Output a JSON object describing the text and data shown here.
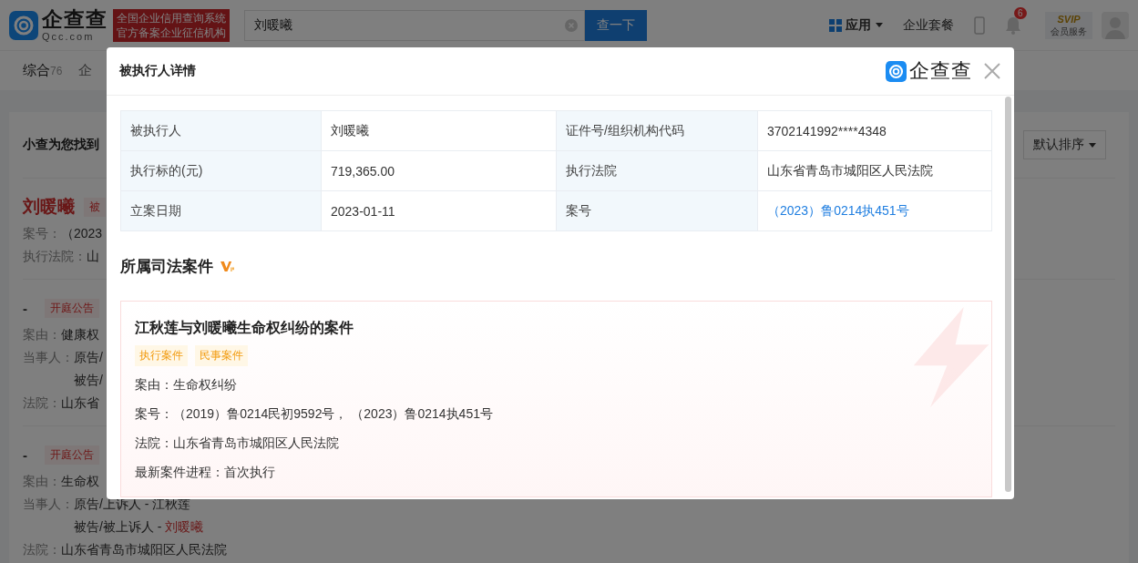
{
  "header": {
    "logo_text": "企查查",
    "logo_domain": "Qcc.com",
    "slogan": [
      "全国企业信用查询系统",
      "官方备案企业征信机构"
    ],
    "search": {
      "value": "刘暖曦"
    },
    "search_button": "查一下",
    "nav": [
      "应用",
      "企业套餐"
    ],
    "notification_count": "6",
    "vip": {
      "badge": "SVIP",
      "label": "会员服务"
    }
  },
  "tabs": [
    {
      "label": "综合",
      "count": "76",
      "selected": true
    },
    {
      "label": "企",
      "selected": false
    }
  ],
  "results": {
    "summary": "小查为您找到",
    "sort_button": "默认排序",
    "items": [
      {
        "kind": "person",
        "title": "刘暖曦",
        "tag": "被",
        "fields": [
          {
            "label": "案号：",
            "lines": [
              {
                "text": "（2023"
              }
            ]
          },
          {
            "label": "执行法院：",
            "lines": [
              {
                "text": "山"
              }
            ]
          }
        ]
      },
      {
        "kind": "notice",
        "title": "-",
        "tag": "开庭公告",
        "fields": [
          {
            "label": "案由：",
            "lines": [
              {
                "text": "健康权"
              }
            ]
          },
          {
            "label": "当事人：",
            "lines": [
              {
                "text": "原告/"
              },
              {
                "text": "被告/"
              }
            ]
          },
          {
            "label": "法院：",
            "lines": [
              {
                "text": "山东省"
              }
            ]
          }
        ]
      },
      {
        "kind": "notice",
        "title": "-",
        "tag": "开庭公告",
        "fields": [
          {
            "label": "案由：",
            "lines": [
              {
                "text": "生命权"
              }
            ]
          },
          {
            "label": "当事人：",
            "lines": [
              {
                "text": "原告/上诉人 - 江秋莲"
              },
              {
                "text": "被告/被上诉人 - ",
                "name": "刘暖曦"
              }
            ]
          },
          {
            "label": "法院：",
            "lines": [
              {
                "text": "山东省青岛市城阳区人民法院"
              }
            ]
          }
        ]
      }
    ]
  },
  "modal": {
    "title": "被执行人详情",
    "logo_text": "企查查",
    "details": [
      {
        "label": "被执行人",
        "value": "刘暖曦",
        "link": false
      },
      {
        "label": "证件号/组织机构代码",
        "value": "3702141992****4348",
        "link": false
      },
      {
        "label": "执行标的(元)",
        "value": "719,365.00",
        "link": false
      },
      {
        "label": "执行法院",
        "value": "山东省青岛市城阳区人民法院",
        "link": false
      },
      {
        "label": "立案日期",
        "value": "2023-01-11",
        "link": false
      },
      {
        "label": "案号",
        "value": "（2023）鲁0214执451号",
        "link": true
      }
    ],
    "section_title": "所属司法案件",
    "case": {
      "title": "江秋莲与刘暖曦生命权纠纷的案件",
      "tags": [
        "执行案件",
        "民事案件"
      ],
      "fields": [
        {
          "label": "案由：",
          "value": "生命权纠纷"
        },
        {
          "label": "案号：",
          "value": "（2019）鲁0214民初9592号，  （2023）鲁0214执451号"
        },
        {
          "label": "法院：",
          "value": "山东省青岛市城阳区人民法院"
        },
        {
          "label": "最新案件进程：",
          "value": "首次执行"
        }
      ]
    }
  }
}
